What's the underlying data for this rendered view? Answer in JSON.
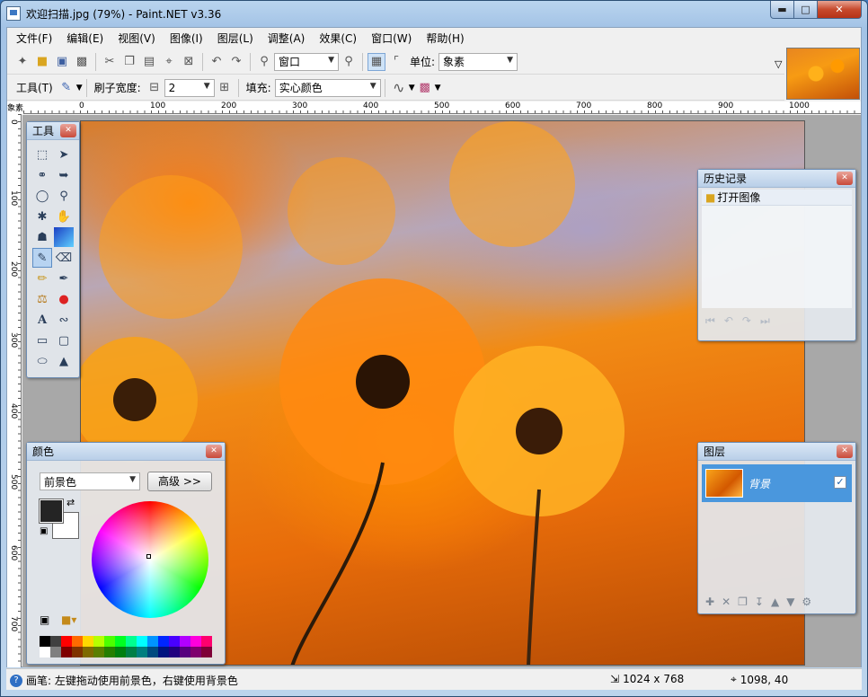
{
  "window": {
    "title": "欢迎扫描.jpg (79%) - Paint.NET v3.36"
  },
  "menu": [
    "文件(F)",
    "编辑(E)",
    "视图(V)",
    "图像(I)",
    "图层(L)",
    "调整(A)",
    "效果(C)",
    "窗口(W)",
    "帮助(H)"
  ],
  "toolbar1": {
    "zoom_value": "窗口",
    "units_label": "单位:",
    "units_value": "象素"
  },
  "toolbar2": {
    "tool_label": "工具(T)",
    "brush_width_label": "刷子宽度:",
    "brush_width_value": "2",
    "fill_label": "填充:",
    "fill_value": "实心颜色"
  },
  "ruler_h": [
    "0",
    "100",
    "200",
    "300",
    "400",
    "500",
    "600",
    "700",
    "800",
    "900",
    "1000"
  ],
  "ruler_v": [
    "0",
    "100",
    "200",
    "300",
    "400",
    "500",
    "600",
    "700"
  ],
  "ruler_corner": "象素",
  "tools_panel": {
    "title": "工具"
  },
  "history_panel": {
    "title": "历史记录",
    "items": [
      "打开图像"
    ]
  },
  "layers_panel": {
    "title": "图层",
    "layers": [
      {
        "name": "背景",
        "visible": true
      }
    ]
  },
  "colors_panel": {
    "title": "颜色",
    "mode_value": "前景色",
    "advanced_label": "高级 >>",
    "primary_color": "#242424",
    "secondary_color": "#ffffff",
    "palette": [
      "#000000",
      "#404040",
      "#ff0000",
      "#ff6a00",
      "#ffd800",
      "#b6ff00",
      "#4cff00",
      "#00ff21",
      "#00ff90",
      "#00ffff",
      "#0094ff",
      "#0026ff",
      "#4800ff",
      "#b200ff",
      "#ff00dc",
      "#ff006e",
      "#ffffff",
      "#808080",
      "#7f0000",
      "#7f3300",
      "#7f6a00",
      "#5b7f00",
      "#267f00",
      "#007f0e",
      "#007f46",
      "#007f7f",
      "#004a7f",
      "#00137f",
      "#21007f",
      "#57007f",
      "#7f006e",
      "#7f0037"
    ]
  },
  "status": {
    "hint": "画笔: 左键拖动使用前景色，右键使用背景色",
    "image_size": "1024 x 768",
    "cursor_pos": "1098, 40"
  }
}
